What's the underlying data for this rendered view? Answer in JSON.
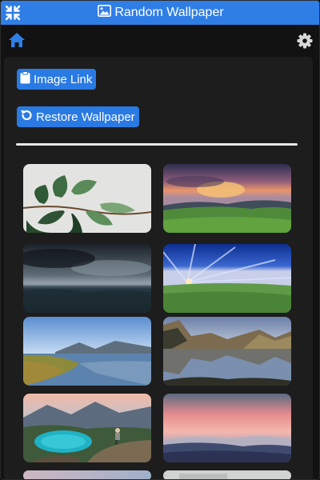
{
  "app": {
    "title": "Random Wallpaper",
    "accent": "#2f7ee6",
    "icons": {
      "collapse": "collapse-arrows-icon",
      "title": "image-icon",
      "home": "home-icon",
      "settings": "gear-icon"
    }
  },
  "actions": {
    "image_link_label": "Image Link",
    "image_link_icon": "clipboard-icon",
    "restore_label": "Restore Wallpaper",
    "restore_icon": "undo-icon"
  },
  "gallery": {
    "thumbnails": [
      "plant-leaves",
      "sunset-meadow",
      "stormy-sea",
      "blue-sky-meadow",
      "lake-mountains",
      "mountain-lake-reflection",
      "alpine-lake-hiker",
      "pink-sky-hills",
      "partial-thumbnail-left",
      "partial-thumbnail-right"
    ]
  }
}
